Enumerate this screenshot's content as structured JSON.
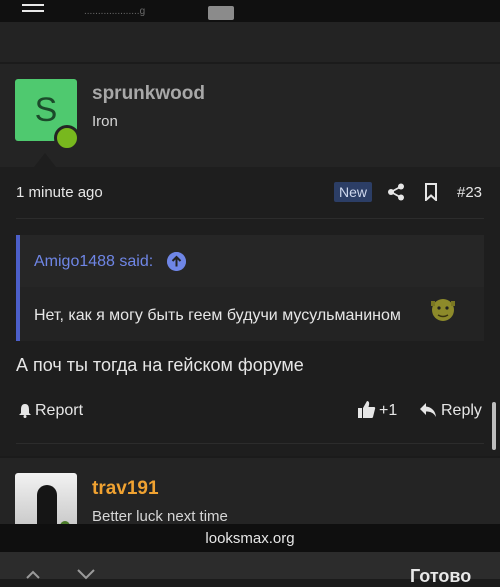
{
  "topbar": {
    "partial_text": "....................g",
    "icon": "hamburger-menu-icon"
  },
  "post": {
    "username": "sprunkwood",
    "user_title": "Iron",
    "avatar_letter": "S",
    "avatar_color": "#4fc96f",
    "time": "1 minute ago",
    "badge": "New",
    "post_number": "#23",
    "quote": {
      "author": "Amigo1488 said:",
      "text": "Нет, как я могу быть геем будучи мусульманином"
    },
    "message": "А поч ты тогда на гейском форуме",
    "actions": {
      "report": "Report",
      "like": "+1",
      "reply": "Reply"
    }
  },
  "next_post": {
    "username": "trav191",
    "user_title": "Better luck next time",
    "username_color": "#f0a231"
  },
  "browser": {
    "url": "looksmax.org",
    "done": "Готово"
  }
}
